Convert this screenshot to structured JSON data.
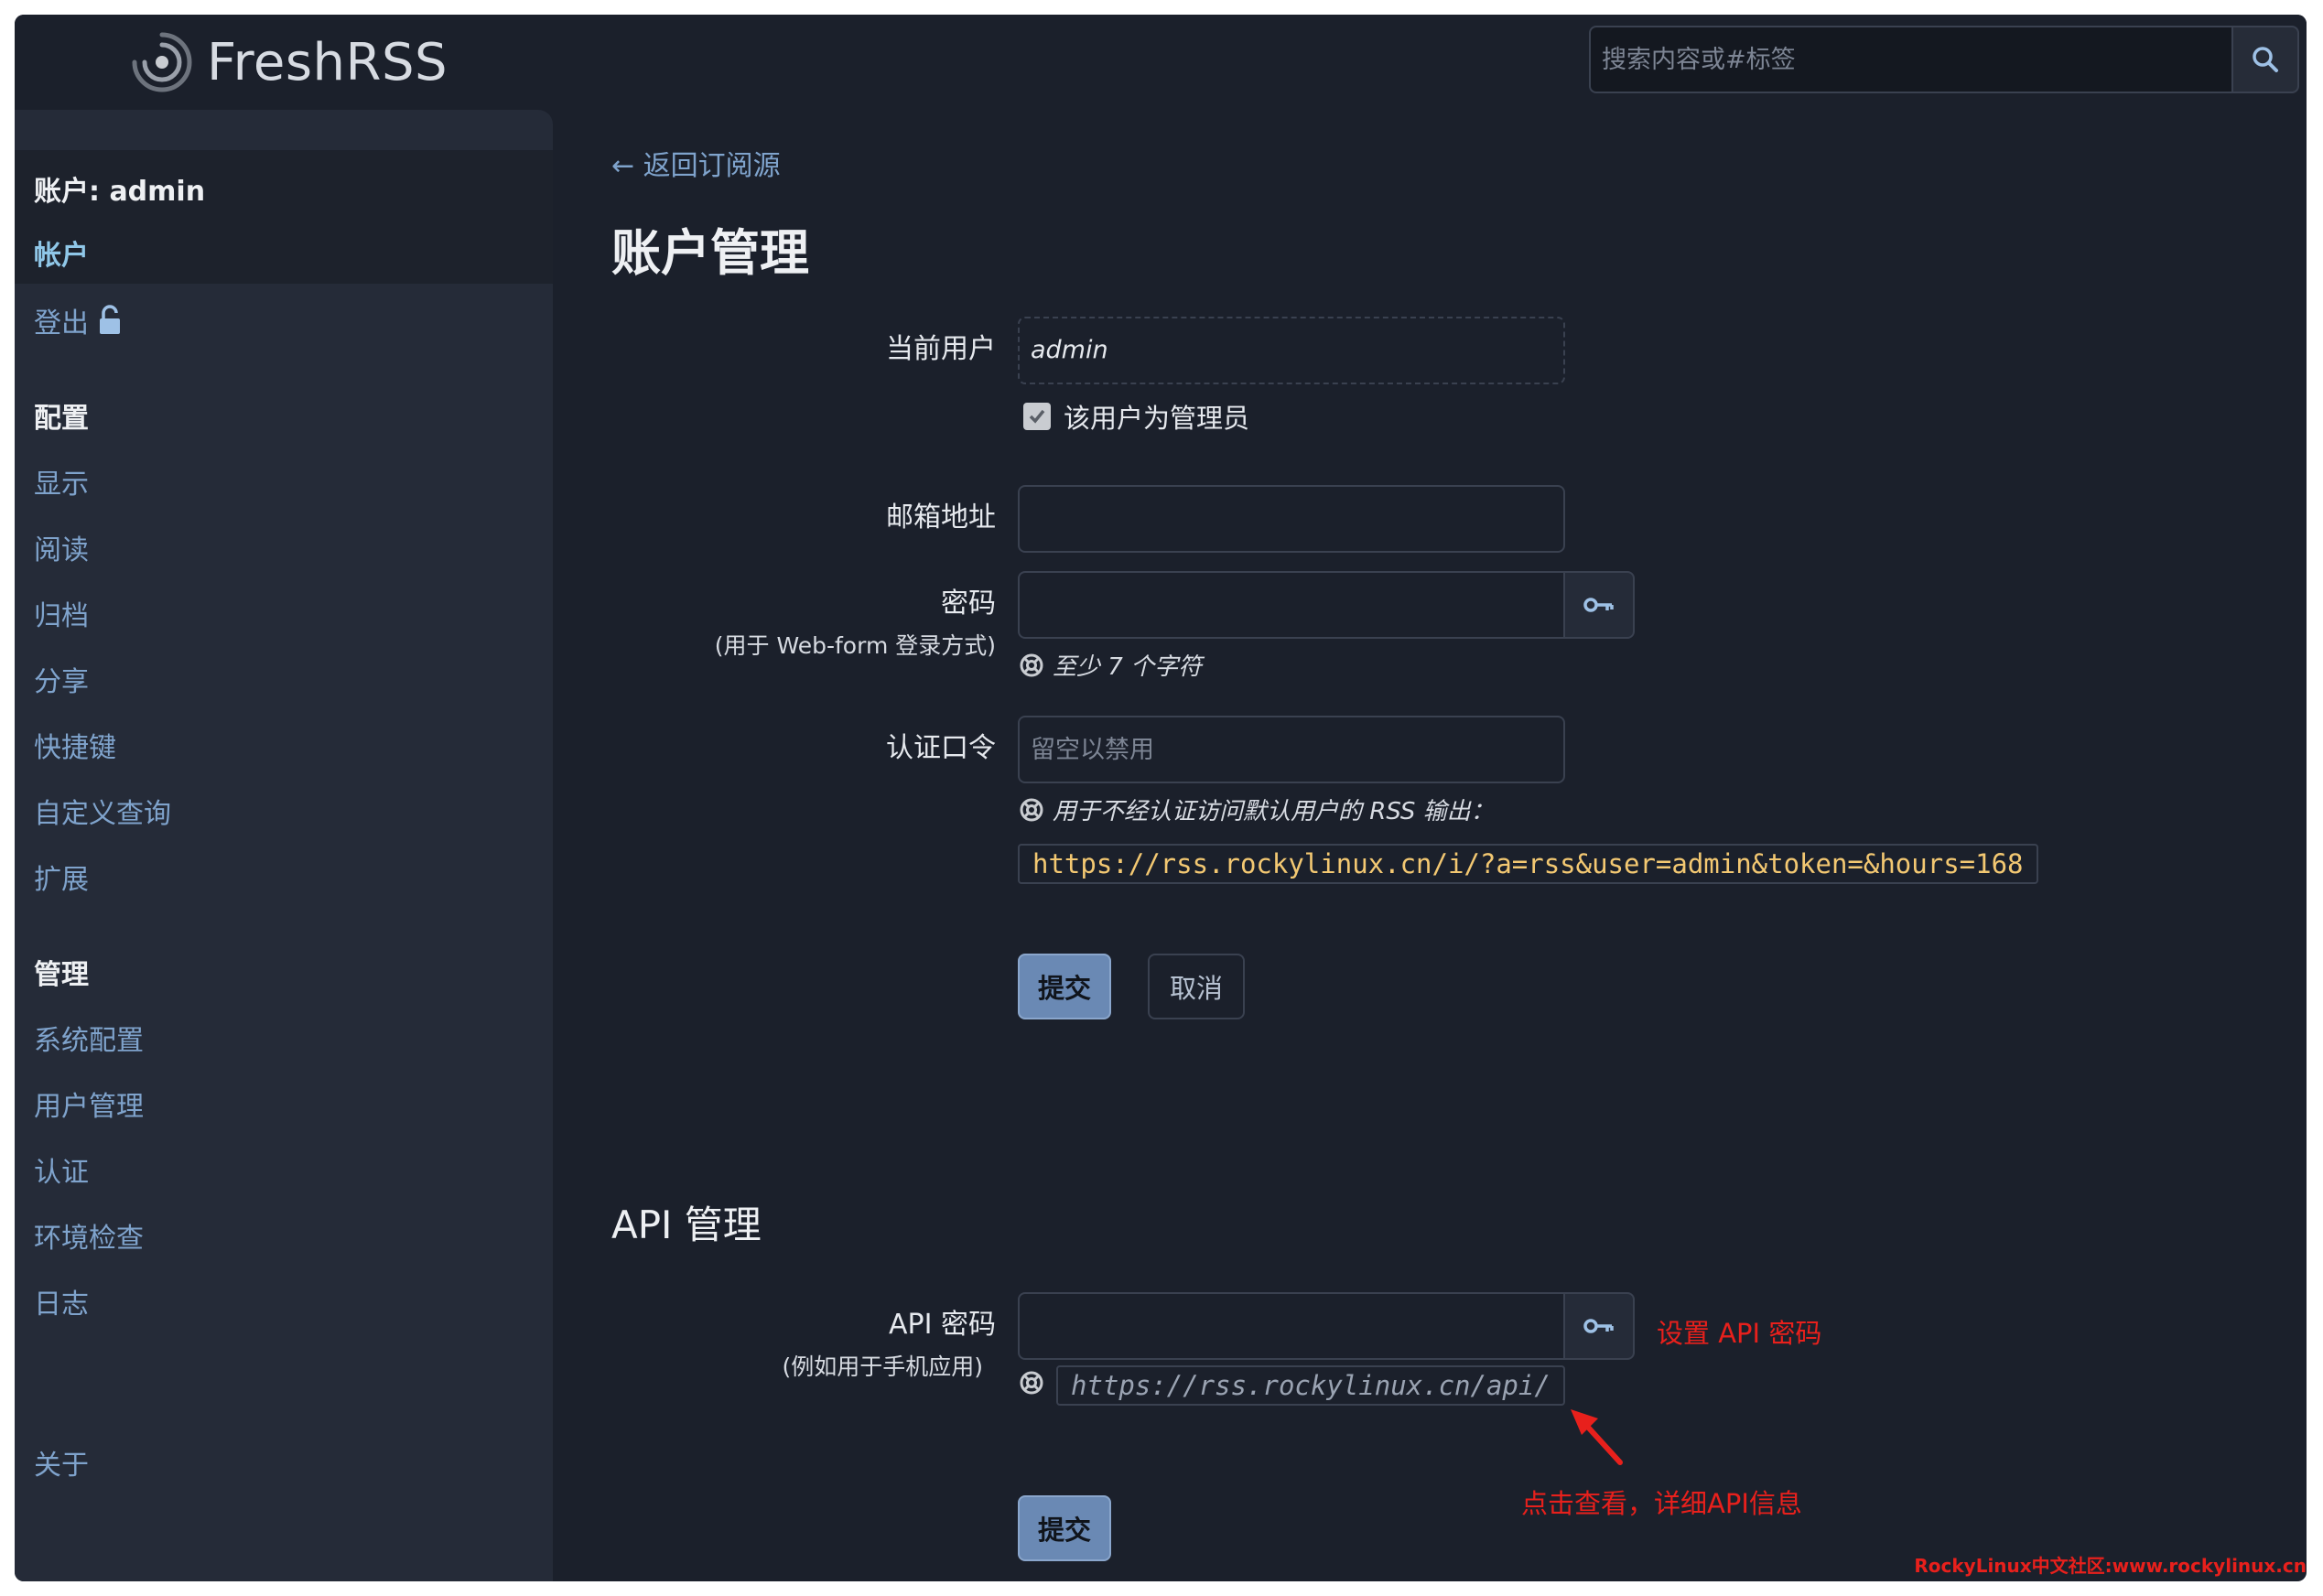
{
  "app": {
    "name": "FreshRSS"
  },
  "search": {
    "placeholder": "搜索内容或#标签"
  },
  "sidebar": {
    "account_header": "账户: admin",
    "account_item": "帐户",
    "logout": "登出",
    "config_header": "配置",
    "config_items": [
      "显示",
      "阅读",
      "归档",
      "分享",
      "快捷键",
      "自定义查询",
      "扩展"
    ],
    "admin_header": "管理",
    "admin_items": [
      "系统配置",
      "用户管理",
      "认证",
      "环境检查",
      "日志"
    ],
    "about": "关于"
  },
  "main": {
    "back_link": "← 返回订阅源",
    "title": "账户管理",
    "current_user_label": "当前用户",
    "current_user_value": "admin",
    "is_admin_label": "该用户为管理员",
    "email_label": "邮箱地址",
    "password_label": "密码",
    "password_sublabel": "(用于 Web-form 登录方式)",
    "password_help": "至少 7 个字符",
    "token_label": "认证口令",
    "token_placeholder": "留空以禁用",
    "token_help": "用于不经认证访问默认用户的 RSS 输出：",
    "rss_url": "https://rss.rockylinux.cn/i/?a=rss&user=admin&token=&hours=168",
    "submit": "提交",
    "cancel": "取消"
  },
  "api": {
    "title": "API 管理",
    "password_label": "API 密码",
    "password_sublabel": "(例如用于手机应用)",
    "api_url": "https://rss.rockylinux.cn/api/",
    "submit": "提交"
  },
  "annotations": {
    "set_api_password": "设置 API 密码",
    "click_to_view": "点击查看，详细API信息",
    "watermark": "RockyLinux中文社区:www.rockylinux.cn"
  },
  "colors": {
    "background": "#1b202b",
    "sidebar": "#252b38",
    "link": "#7fa3cc",
    "primary_button": "#6a89b4",
    "annotation": "#e8201c",
    "code_text": "#f3c872"
  }
}
